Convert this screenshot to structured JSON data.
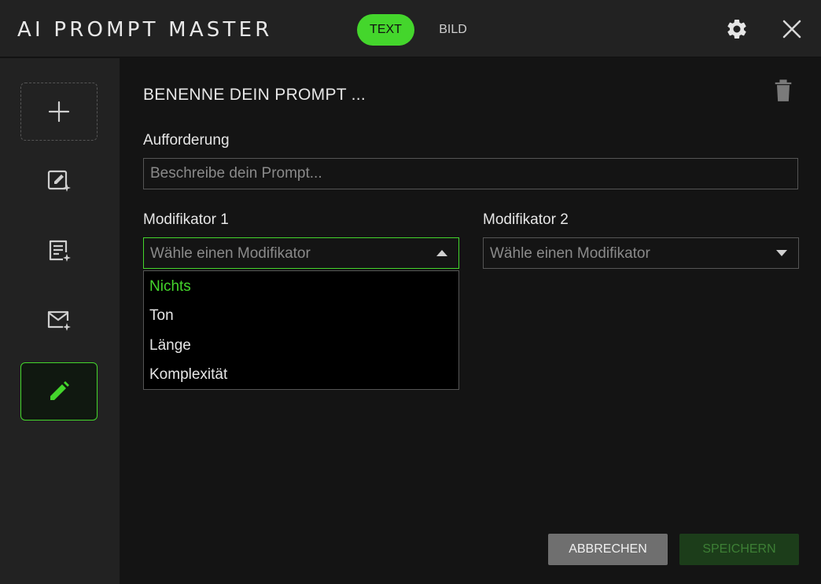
{
  "app": {
    "title": "AI PROMPT MASTER"
  },
  "tabs": [
    {
      "label": "TEXT",
      "active": true
    },
    {
      "label": "BILD",
      "active": false
    }
  ],
  "toolbar": {
    "settings_icon": "gear-icon",
    "close_icon": "close-icon"
  },
  "sidebar": {
    "items": [
      {
        "icon": "plus-icon",
        "kind": "add"
      },
      {
        "icon": "edit-sparkle-icon"
      },
      {
        "icon": "document-sparkle-icon"
      },
      {
        "icon": "mail-sparkle-icon"
      },
      {
        "icon": "pencil-icon",
        "active": true
      }
    ]
  },
  "editor": {
    "prompt_name": "BENENNE DEIN PROMPT ...",
    "delete_icon": "trash-icon",
    "request_label": "Aufforderung",
    "request_placeholder": "Beschreibe dein Prompt...",
    "modifier1": {
      "label": "Modifikator 1",
      "placeholder": "Wähle einen Modifikator",
      "open": true,
      "options": [
        "Nichts",
        "Ton",
        "Länge",
        "Komplexität"
      ],
      "highlighted": "Nichts"
    },
    "modifier2": {
      "label": "Modifikator 2",
      "placeholder": "Wähle einen Modifikator",
      "open": false
    }
  },
  "actions": {
    "cancel_label": "ABBRECHEN",
    "save_label": "SPEICHERN"
  },
  "colors": {
    "accent": "#44d62c",
    "background": "#141414",
    "panel": "#222222"
  }
}
